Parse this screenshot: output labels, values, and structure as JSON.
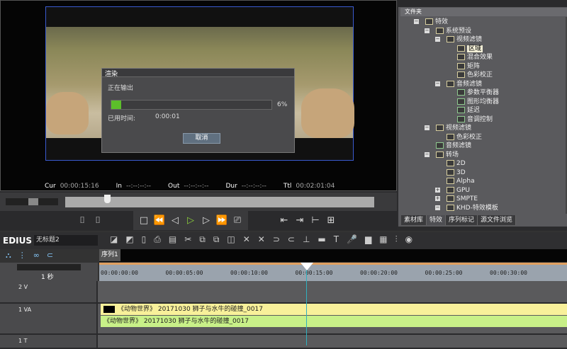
{
  "player": {
    "cur_label": "Cur",
    "cur": "00:00:15:16",
    "in_label": "In",
    "in": "--:--:--:--",
    "out_label": "Out",
    "out": "--:--:--:--",
    "dur_label": "Dur",
    "dur": "--:--:--:--",
    "ttl_label": "Ttl",
    "ttl": "00:02:01:04"
  },
  "render_dialog": {
    "title": "渲染",
    "status": "正在输出",
    "progress_percent": 6,
    "progress_label": "6%",
    "elapsed_label": "已用时间:",
    "elapsed": "0:00:01",
    "cancel": "取消"
  },
  "folder_panel": {
    "header": "文件夹",
    "items": [
      {
        "label": "特效",
        "level": 0,
        "icon": "folder"
      },
      {
        "label": "系统预设",
        "level": 1,
        "icon": "folder"
      },
      {
        "label": "视频滤镜",
        "level": 2,
        "icon": "folder"
      },
      {
        "label": "区域",
        "level": 3,
        "icon": "video-filter",
        "selected": true
      },
      {
        "label": "混合效果",
        "level": 3,
        "icon": "video-filter"
      },
      {
        "label": "矩阵",
        "level": 3,
        "icon": "video-filter"
      },
      {
        "label": "色彩校正",
        "level": 3,
        "icon": "video-filter"
      },
      {
        "label": "音频滤镜",
        "level": 2,
        "icon": "folder"
      },
      {
        "label": "参数平衡器",
        "level": 3,
        "icon": "audio-filter"
      },
      {
        "label": "图形均衡器",
        "level": 3,
        "icon": "audio-filter"
      },
      {
        "label": "延迟",
        "level": 3,
        "icon": "audio-filter"
      },
      {
        "label": "音调控制",
        "level": 3,
        "icon": "audio-filter"
      },
      {
        "label": "视频滤镜",
        "level": 1,
        "icon": "folder"
      },
      {
        "label": "色彩校正",
        "level": 2,
        "icon": "video-filter"
      },
      {
        "label": "音频滤镜",
        "level": 1,
        "icon": "audio-filter"
      },
      {
        "label": "转场",
        "level": 1,
        "icon": "folder"
      },
      {
        "label": "2D",
        "level": 2,
        "icon": "transition"
      },
      {
        "label": "3D",
        "level": 2,
        "icon": "transition"
      },
      {
        "label": "Alpha",
        "level": 2,
        "icon": "transition"
      },
      {
        "label": "GPU",
        "level": 2,
        "icon": "transition"
      },
      {
        "label": "SMPTE",
        "level": 2,
        "icon": "transition"
      },
      {
        "label": "KHD-特效模板",
        "level": 2,
        "icon": "folder"
      }
    ],
    "tabs": [
      "素材库",
      "特效",
      "序列标记",
      "源文件浏览"
    ],
    "active_tab": "特效"
  },
  "timeline": {
    "app": "EDIUS",
    "project": "无标题2",
    "sequence_tab": "序列1",
    "scale": "1 秒",
    "ruler": [
      "00:00:00:00",
      "00:00:05:00",
      "00:00:10:00",
      "00:00:15:00",
      "00:00:20:00",
      "00:00:25:00",
      "00:00:30:00"
    ],
    "tracks": [
      {
        "name": "2 V"
      },
      {
        "name": "1 VA",
        "video_clip": "《动物世界》 20171030 狮子与水牛的碰撞_0017",
        "audio_clip": "《动物世界》 20171030 狮子与水牛的碰撞_0017"
      },
      {
        "name": "1 T"
      }
    ]
  },
  "colors": {
    "progress": "#5cbf2a",
    "video_clip": "#f8f09a",
    "audio_clip": "#c8f088",
    "ruler": "#9aa3ad",
    "playhead": "#2fb0c0"
  }
}
